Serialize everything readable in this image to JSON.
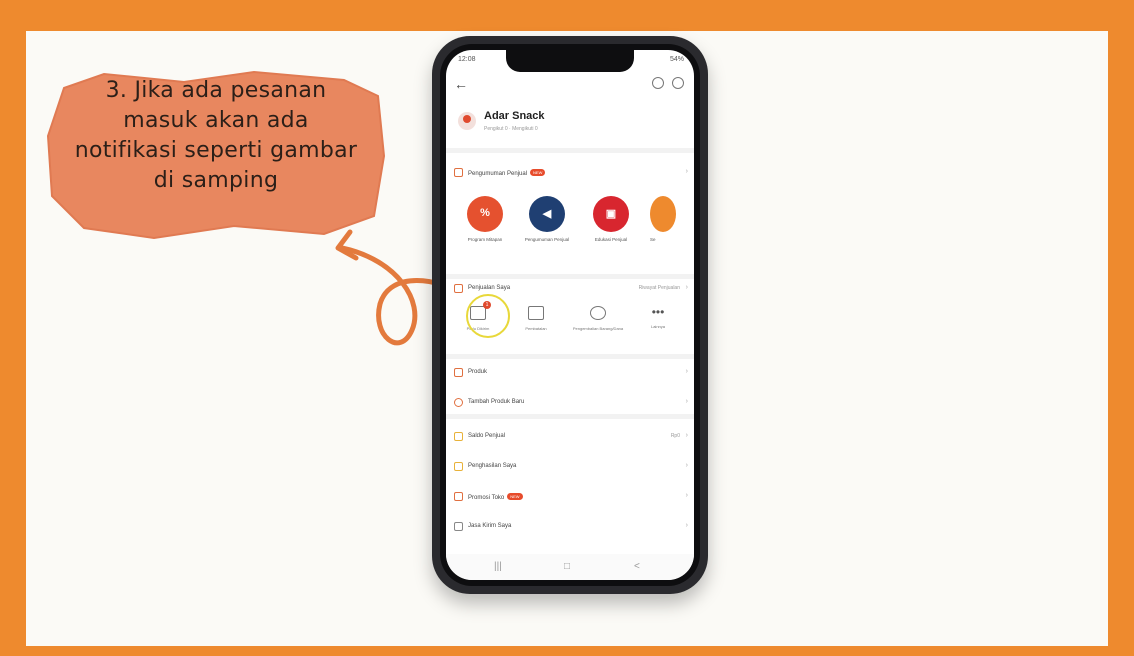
{
  "callout": {
    "text_lines": [
      "3. Jika ada pesanan",
      "masuk akan ada",
      "notifikasi seperti gambar",
      "di samping"
    ]
  },
  "phone": {
    "status_time": "12:08",
    "status_right": "54%",
    "shop": {
      "name": "Adar Snack",
      "sub": "Pengikut 0 · Mengikuti 0"
    },
    "announcement_row": {
      "label": "Pengumuman Penjual",
      "badge": "NEW"
    },
    "circles": [
      {
        "label": "Program Mitapan",
        "glyph": "%",
        "color": "#e5512f"
      },
      {
        "label": "Pengumuman Penjual",
        "glyph": "◀",
        "color": "#1f3f72"
      },
      {
        "label": "Edukasi Penjual",
        "glyph": "▣",
        "color": "#d8262f"
      },
      {
        "label": "Se",
        "glyph": "",
        "color": "#ee8a2e"
      }
    ],
    "sales_row": {
      "label": "Penjualan Saya",
      "right": "Riwayat Penjualan"
    },
    "actions": [
      {
        "label": "Perlu Dikirim",
        "badge": "1"
      },
      {
        "label": "Pembatalan",
        "badge": ""
      },
      {
        "label": "Pengembalian Barang/Dana",
        "badge": ""
      },
      {
        "label": "Lainnya",
        "badge": ""
      }
    ],
    "menu": [
      {
        "label": "Produk",
        "badge": "",
        "right": ""
      },
      {
        "label": "Tambah Produk Baru",
        "badge": "",
        "right": ""
      },
      {
        "label": "Saldo Penjual",
        "badge": "",
        "right": "Rp0"
      },
      {
        "label": "Penghasilan Saya",
        "badge": "",
        "right": ""
      },
      {
        "label": "Promosi Toko",
        "badge": "NEW",
        "right": ""
      },
      {
        "label": "Jasa Kirim Saya",
        "badge": "",
        "right": ""
      }
    ],
    "nav": [
      "|||",
      "□",
      "<"
    ]
  },
  "colors": {
    "frame": "#ee8a2e",
    "callout_fill": "#e8875f",
    "arrow": "#e37a3d",
    "highlight": "#e8d83a"
  }
}
